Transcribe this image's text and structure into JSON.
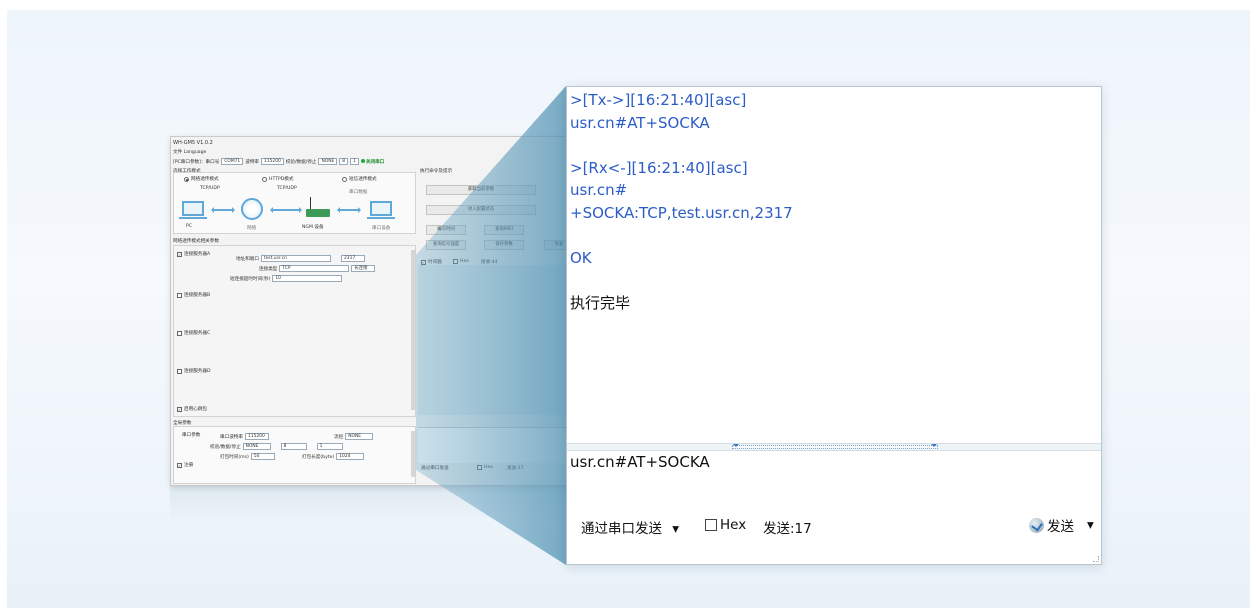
{
  "app": {
    "title": "WH-GM5 V1.0.2",
    "menu": "文件  Language",
    "toolbar": {
      "port_label": "[PC串口参数]：串口号",
      "port_value": "COM71",
      "baud_label": "波特率",
      "baud_value": "115200",
      "parity_label": "校验/数据/停止",
      "parity_value": "NONE",
      "data_value": "8",
      "stop_value": "1",
      "open_button": "关闭串口"
    },
    "mode_section": {
      "label": "选择工作模式",
      "radio_net": "网络透传模式",
      "radio_http": "HTTPD模式",
      "radio_sms": "短信透传模式",
      "proto_left": "TCP/UDP",
      "proto_right": "TCP/UDP",
      "serial_label": "串口数据",
      "pc_label": "PC",
      "net_label": "网络",
      "dev_label": "NGM 设备",
      "serial_dev_label": "串口设备"
    },
    "params_section": {
      "label": "网络透传模式相关参数",
      "server_a": "连接服务器A",
      "addr_label": "地址和端口",
      "addr_value": "test.usr.cn",
      "port_value": "2317",
      "type_label": "连接类型",
      "type_value": "TCP",
      "long_conn": "长连接",
      "reconnect_label": "短连接超时时间(秒)",
      "reconnect_value": "10",
      "server_b": "连接服务器B",
      "server_c": "连接服务器C",
      "server_d": "连接服务器D",
      "heartbeat": "启用心跳包"
    },
    "global_section": {
      "label": "全局参数",
      "serial_params": "串口参数",
      "baud_label": "串口波特率",
      "baud_value": "115200",
      "flow_label": "流控",
      "flow_value": "NONE",
      "parity_label": "校验/数据/停止",
      "parity_value": "NONE",
      "data_value": "8",
      "stop_value": "1",
      "pack_time_label": "打包时间(ms)",
      "pack_time_value": "50",
      "pack_len_label": "打包长度(byte)",
      "pack_len_value": "1024",
      "register_label": "注册"
    },
    "cmd_section": {
      "label": "执行命令及提示",
      "get_params": "获取当前参数",
      "enter_config": "进入配置状态",
      "save_time": "编写时间",
      "query_imei": "查询IMEI",
      "query_signal": "查询信号强度",
      "save_params": "保存参数",
      "restore": "恢复",
      "timestamp": "时间戳",
      "hex": "Hex",
      "recv_count": "接收:44",
      "send_mode": "通过串口发送",
      "tx_hex": "Hex",
      "send_count": "发送:17"
    }
  },
  "terminal": {
    "log": [
      ">[Tx->][16:21:40][asc]",
      "usr.cn#AT+SOCKA",
      "",
      ">[Rx<-][16:21:40][asc]",
      "usr.cn#",
      "+SOCKA:TCP,test.usr.cn,2317",
      "",
      "OK",
      "",
      "执行完毕"
    ],
    "tx_input": "usr.cn#AT+SOCKA",
    "send_mode_label": "通过串口发送",
    "dropdown_arrow": "▾",
    "hex_label": "Hex",
    "send_count": "发送:17",
    "send_button": "发送",
    "send_arrow": "▾"
  }
}
